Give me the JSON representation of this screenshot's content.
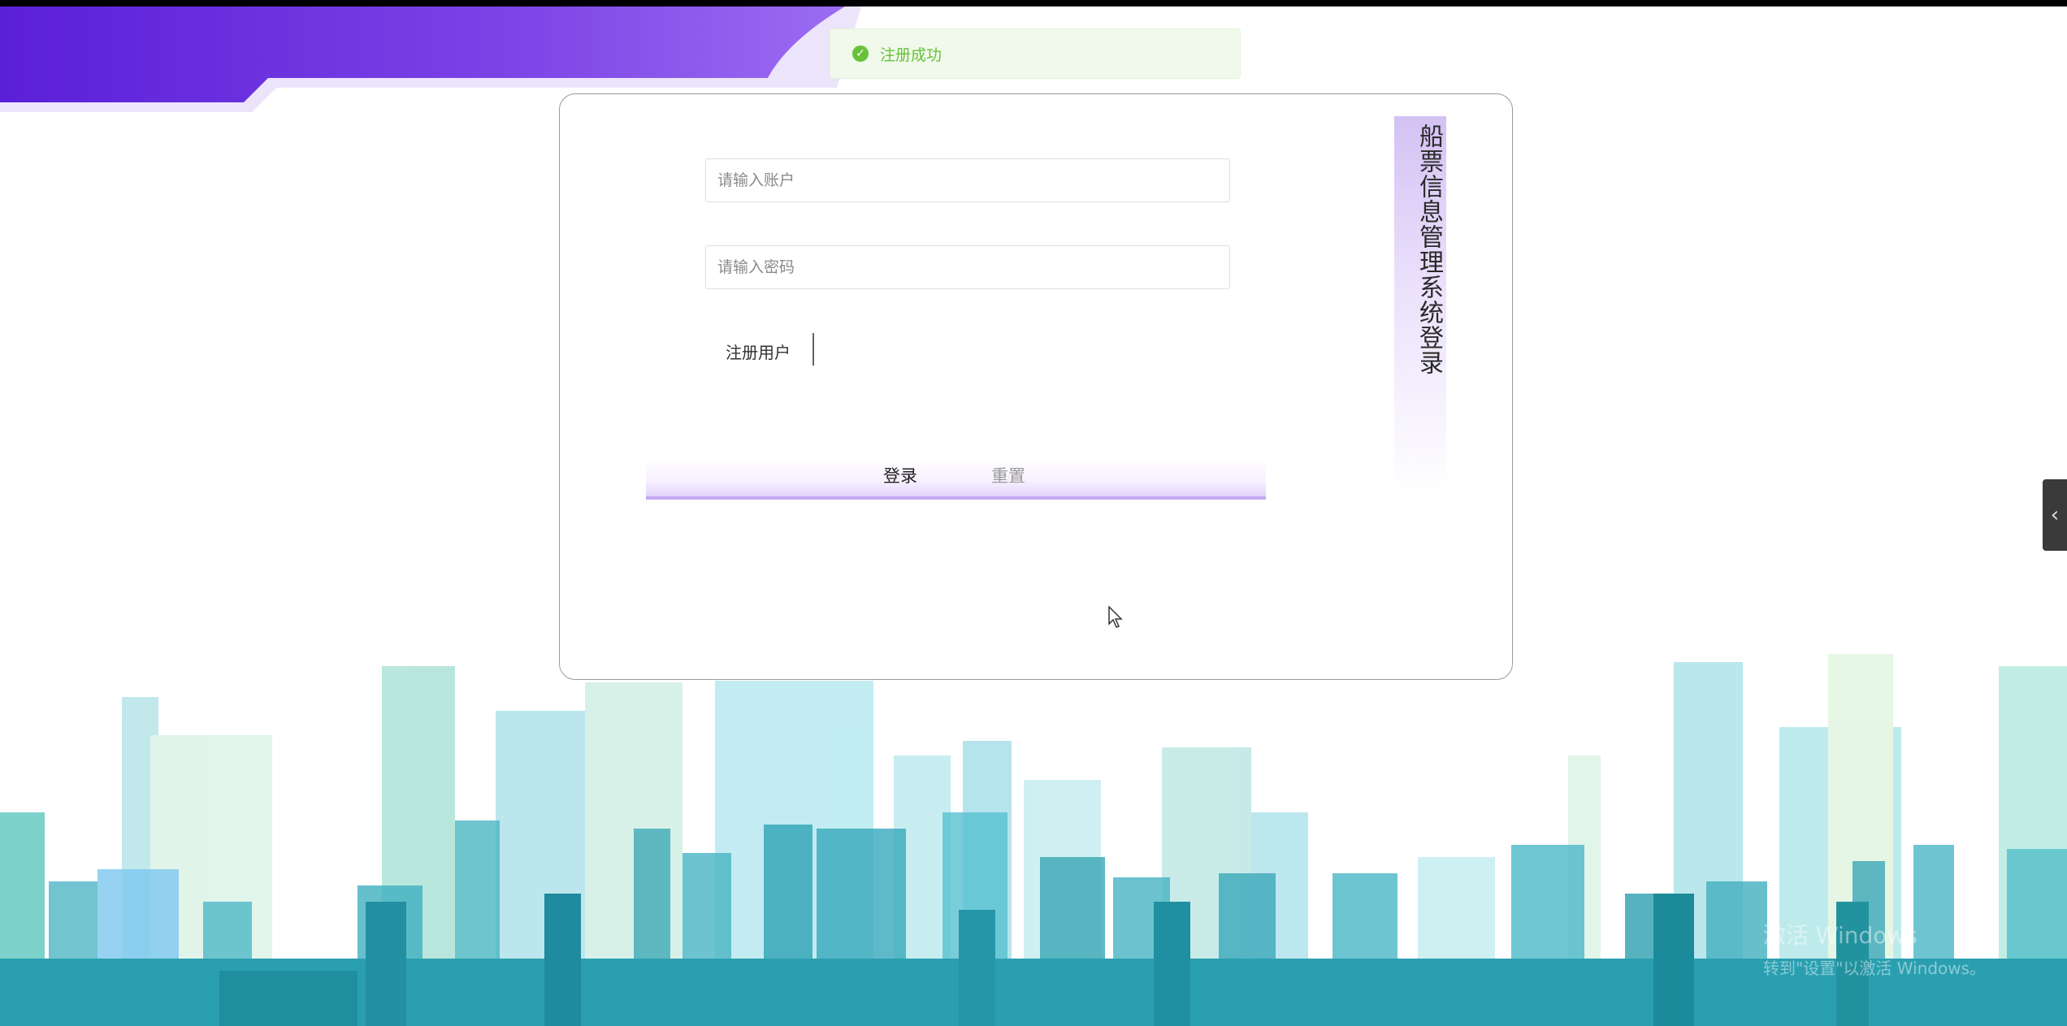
{
  "toast": {
    "message": "注册成功",
    "icon": "success-check-icon",
    "color": "#67c23a"
  },
  "login": {
    "title": "船票信息管理系统登录",
    "account_placeholder": "请输入账户",
    "password_placeholder": "请输入密码",
    "register_label": "注册用户",
    "login_button": "登录",
    "reset_button": "重置"
  },
  "side_handle": {
    "icon": "chevron-left-icon"
  },
  "watermark": {
    "line1": "激活 Windows",
    "line2": "转到\"设置\"以激活 Windows。"
  },
  "colors": {
    "accent_purple": "#6a2be0",
    "success": "#67c23a",
    "city_teal": "#2aa8b8"
  }
}
